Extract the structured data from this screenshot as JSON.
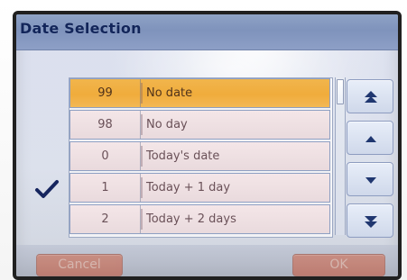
{
  "window": {
    "title": "Date Selection"
  },
  "list": {
    "rows": [
      {
        "value": "99",
        "label": "No date",
        "selected": true
      },
      {
        "value": "98",
        "label": "No day",
        "selected": false
      },
      {
        "value": "0",
        "label": "Today's date",
        "selected": false
      },
      {
        "value": "1",
        "label": "Today + 1 day",
        "selected": false
      },
      {
        "value": "2",
        "label": "Today + 2 days",
        "selected": false
      }
    ]
  },
  "buttons": {
    "cancel": "Cancel",
    "ok": "OK"
  },
  "icons": {
    "check": "checkmark-icon",
    "page_up": "double-up-arrow-icon",
    "line_up": "up-arrow-icon",
    "line_down": "down-arrow-icon",
    "page_down": "double-down-arrow-icon"
  },
  "colors": {
    "selected_row": "#f0ac3c",
    "title_bar": "#8597c0",
    "title_text": "#12255a",
    "button_fill": "#c4867a"
  }
}
